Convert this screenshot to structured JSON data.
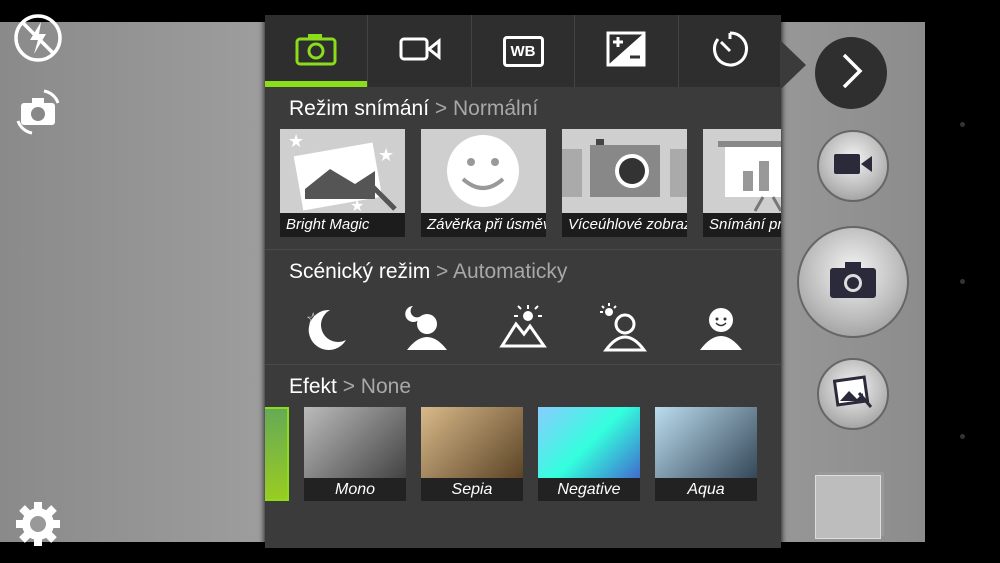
{
  "left_controls": {
    "flash": "flash-off-icon",
    "switch_camera": "switch-camera-icon",
    "settings": "gear-icon"
  },
  "tabs": [
    {
      "icon": "camera-icon",
      "active": true
    },
    {
      "icon": "video-icon"
    },
    {
      "icon": "white-balance-icon",
      "label": "WB"
    },
    {
      "icon": "exposure-icon"
    },
    {
      "icon": "timer-icon"
    }
  ],
  "shooting_mode": {
    "title": "Režim snímání",
    "value": "> Normální",
    "items": [
      "Bright Magic",
      "Závěrka při úsměvu",
      "Víceúhlové zobrazení",
      "Snímání prezentace"
    ]
  },
  "scene_mode": {
    "title": "Scénický režim",
    "value": "> Automaticky",
    "icons": [
      "night-icon",
      "night-portrait-icon",
      "landscape-icon",
      "backlight-portrait-icon",
      "portrait-icon"
    ]
  },
  "effect": {
    "title": "Efekt",
    "value": "> None",
    "items": [
      "Mono",
      "Sepia",
      "Negative",
      "Aqua"
    ]
  },
  "colors": {
    "accent": "#8bdc1a",
    "panel": "#3b3b3b"
  },
  "right_controls": {
    "expand": "chevron-right-icon",
    "video": "video-record-icon",
    "shutter": "camera-shutter-icon",
    "gallery": "gallery-edit-icon"
  }
}
